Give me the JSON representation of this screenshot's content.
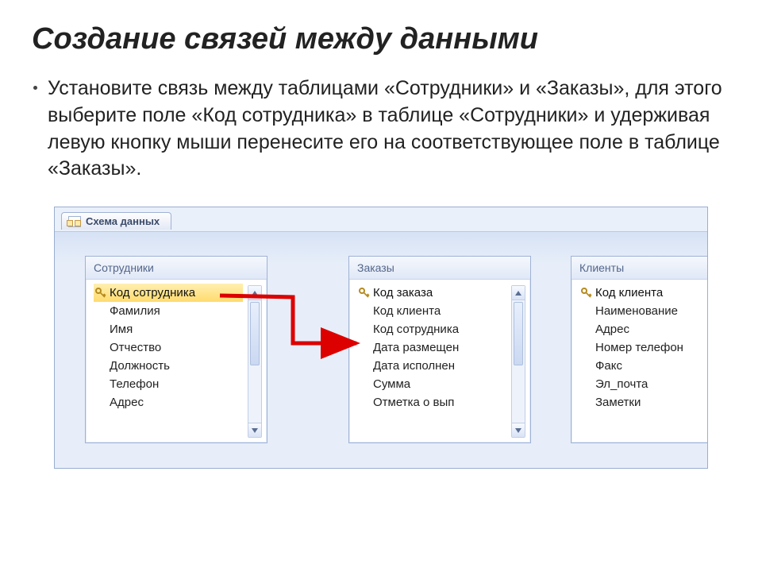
{
  "title": "Создание связей между данными",
  "body": "Установите связь между таблицами «Сотрудники» и «Заказы», для этого выберите поле «Код сотрудника» в таблице «Сотрудники» и удерживая левую кнопку мыши перенесите его на соответствующее поле в таблице «Заказы».",
  "tab_label": "Схема данных",
  "tables": {
    "employees": {
      "title": "Сотрудники",
      "fields": [
        "Код сотрудника",
        "Фамилия",
        "Имя",
        "Отчество",
        "Должность",
        "Телефон",
        "Адрес"
      ]
    },
    "orders": {
      "title": "Заказы",
      "fields": [
        "Код заказа",
        "Код клиента",
        "Код сотрудника",
        "Дата размещен",
        "Дата исполнен",
        "Сумма",
        "Отметка о вып"
      ]
    },
    "clients": {
      "title": "Клиенты",
      "fields": [
        "Код клиента",
        "Наименование",
        "Адрес",
        "Номер телефон",
        "Факс",
        "Эл_почта",
        "Заметки"
      ]
    }
  }
}
